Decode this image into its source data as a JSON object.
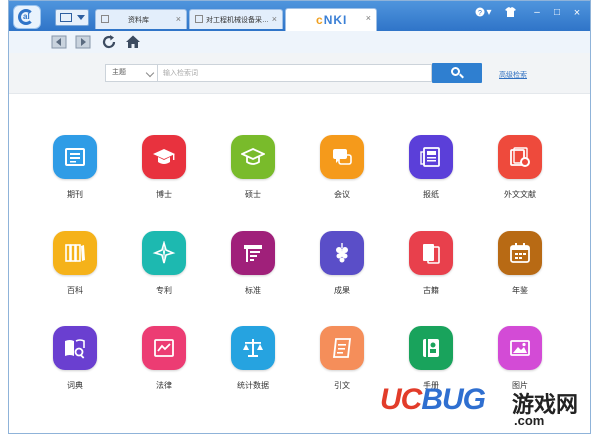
{
  "window": {
    "tabs": [
      {
        "label": "资料库",
        "active": false
      },
      {
        "label": "对工程机械设备采…",
        "active": false
      },
      {
        "label": "",
        "active": true
      }
    ],
    "brand": {
      "logo_text": "CNKI"
    },
    "controls": [
      "?",
      "▾",
      "☐",
      "–",
      "□",
      "×"
    ]
  },
  "toolbar": {
    "buttons": [
      "back-icon",
      "forward-icon",
      "refresh-icon",
      "home-icon"
    ]
  },
  "search": {
    "scope_label": "主题",
    "placeholder": "输入检索词",
    "advanced_label": "高级检索"
  },
  "categories": [
    {
      "label": "期刊",
      "color": "#2f9ce6",
      "icon": "journal-icon"
    },
    {
      "label": "博士",
      "color": "#e8323e",
      "icon": "doctor-cap-icon"
    },
    {
      "label": "硕士",
      "color": "#79bb2b",
      "icon": "master-cap-icon"
    },
    {
      "label": "会议",
      "color": "#f59a1b",
      "icon": "meeting-icon"
    },
    {
      "label": "报纸",
      "color": "#5b3fd9",
      "icon": "newspaper-icon"
    },
    {
      "label": "外文文献",
      "color": "#ee4a3c",
      "icon": "foreign-docs-icon"
    },
    {
      "label": "百科",
      "color": "#f5b21a",
      "icon": "encyclopedia-icon"
    },
    {
      "label": "专利",
      "color": "#1db9b0",
      "icon": "patent-icon"
    },
    {
      "label": "标准",
      "color": "#a0207a",
      "icon": "standard-icon"
    },
    {
      "label": "成果",
      "color": "#5a4ec8",
      "icon": "achievement-icon"
    },
    {
      "label": "古籍",
      "color": "#e8404c",
      "icon": "ancient-books-icon"
    },
    {
      "label": "年鉴",
      "color": "#b86a14",
      "icon": "yearbook-icon"
    },
    {
      "label": "词典",
      "color": "#6a3fd0",
      "icon": "dictionary-icon"
    },
    {
      "label": "法律",
      "color": "#ec3c73",
      "icon": "law-icon"
    },
    {
      "label": "统计数据",
      "color": "#26a3e0",
      "icon": "statistics-icon"
    },
    {
      "label": "引文",
      "color": "#f58e5a",
      "icon": "citation-icon"
    },
    {
      "label": "手册",
      "color": "#19a35c",
      "icon": "handbook-icon"
    },
    {
      "label": "图片",
      "color": "#d34bd6",
      "icon": "picture-icon"
    }
  ],
  "watermark": {
    "part1": "UC",
    "part2": "BUG",
    "cn": "游戏网",
    "domain": ".com"
  }
}
